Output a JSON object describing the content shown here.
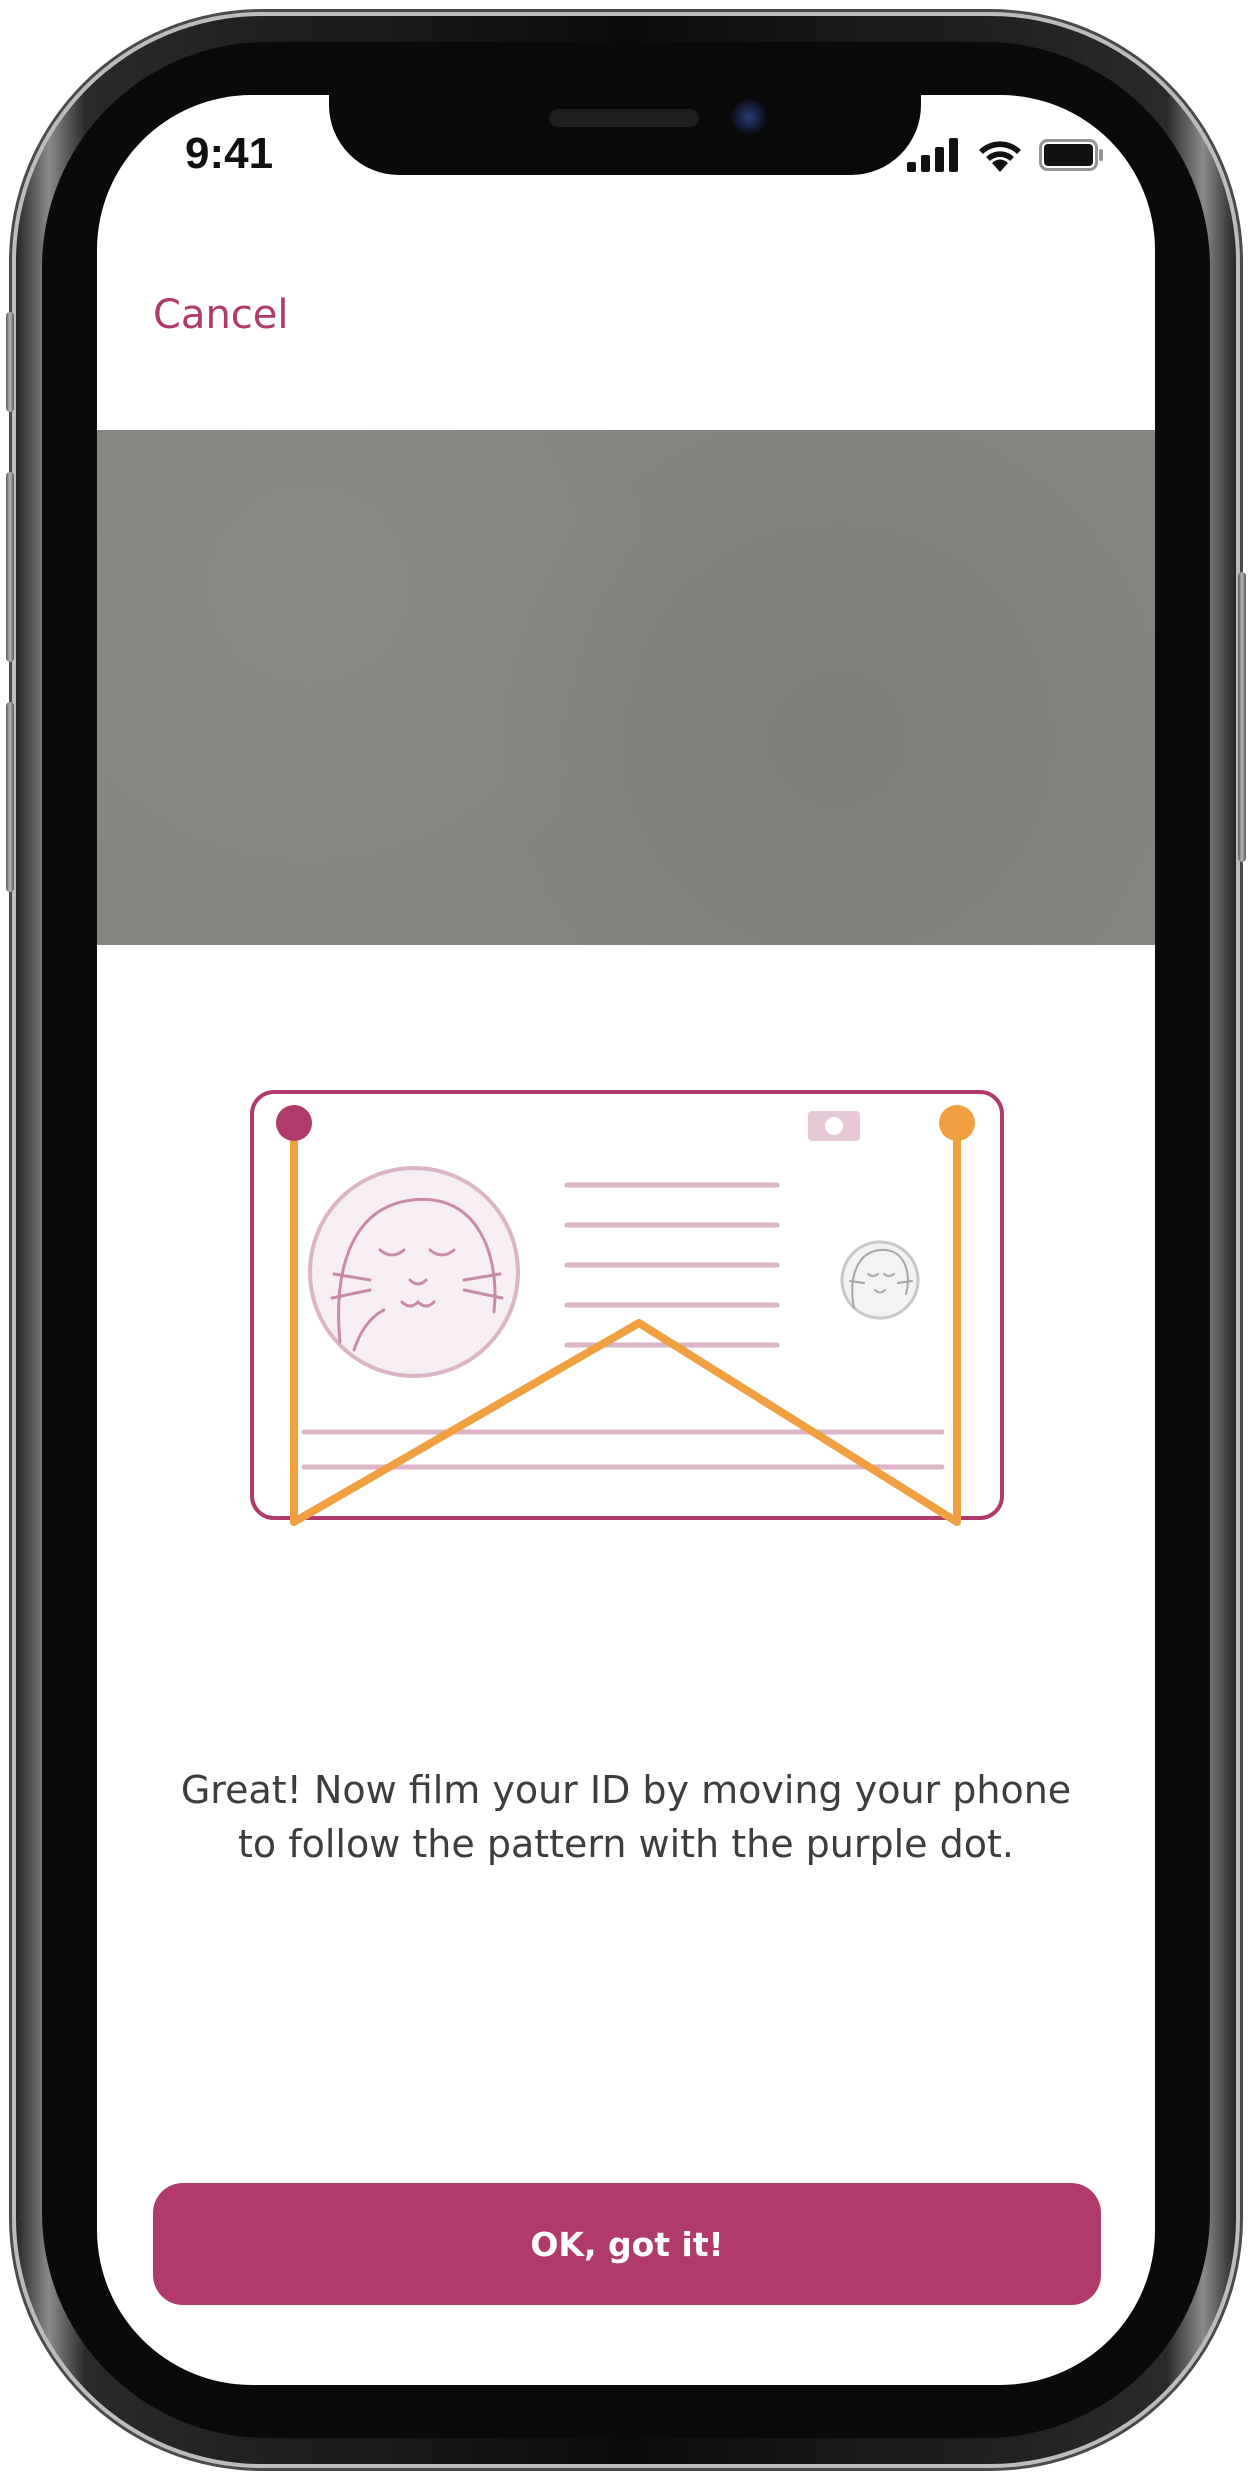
{
  "status_bar": {
    "time": "9:41",
    "icons": [
      "cellular-signal-icon",
      "wifi-icon",
      "battery-icon"
    ]
  },
  "nav": {
    "cancel_label": "Cancel"
  },
  "instruction": {
    "text": "Great! Now film your ID by moving your phone to follow the pattern with the purple dot."
  },
  "actions": {
    "ok_label": "OK, got it!"
  },
  "theme": {
    "accent": "#b03a6c",
    "pattern_orange": "#f0a040",
    "card_line": "#dcb4c6",
    "camera_gray": "#86847f"
  }
}
